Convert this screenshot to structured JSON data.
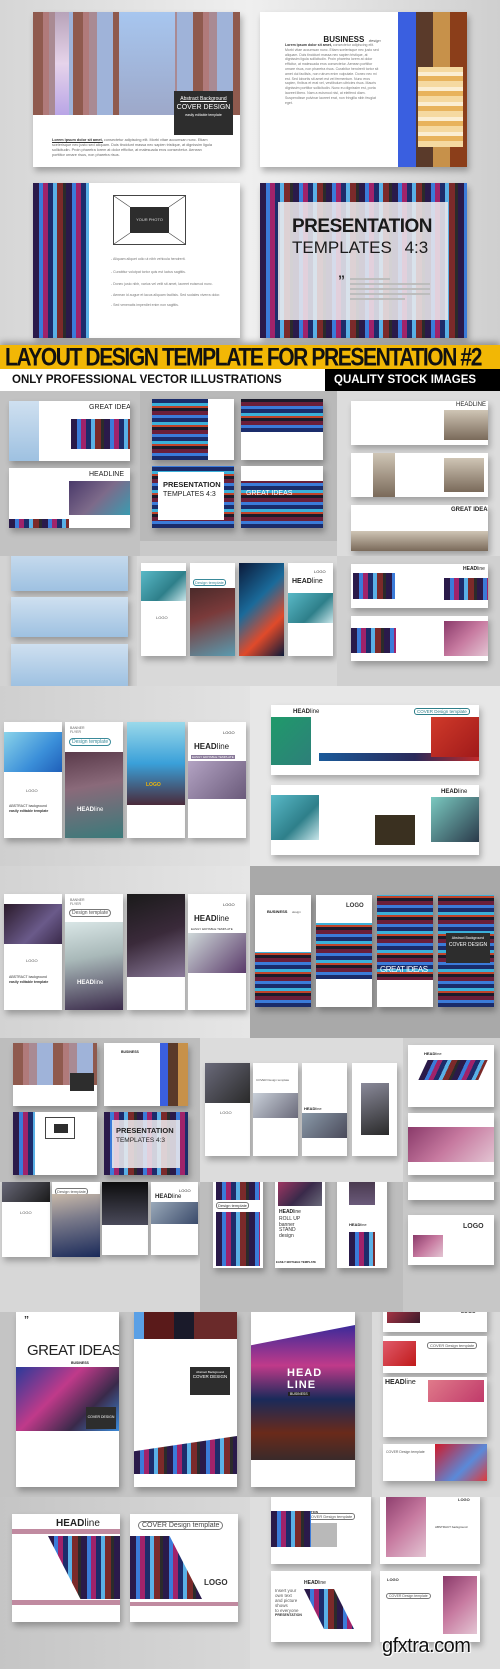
{
  "banner": {
    "title": "LAYOUT DESIGN TEMPLATE FOR PRESENTATION #2",
    "left_tag": "ONLY PROFESSIONAL VECTOR ILLUSTRATIONS",
    "right_tag": "QUALITY STOCK IMAGES",
    "bg_color": "#f2b705",
    "title_color": "#111111"
  },
  "hero": {
    "slide1": {
      "cover_small": "Abstract Background",
      "cover_big": "COVER DESIGN",
      "cover_sub": "easily editable template",
      "body_lead": "Lorem ipsum dolor sit amet,",
      "body": "consectetur adipiscing elit. Morbi vitae accumsan nunc. Etiam scelerisque nec justo sed aliquam. Duis tincidunt massa nec sapien tristique, at dignissim ligula sollicitudin. Proin pharetra lorem at dolor efficitur, at malesuada eros consectetur. Aenean porttitor ornare risus, non pharetra risus."
    },
    "slide2": {
      "title": "BUSINESS",
      "title_suffix": "design",
      "body_lead": "Lorem ipsum dolor sit amet,",
      "body": "consectetur adipiscing elit. Morbi vitae accumsan nunc. Etiam scelerisque nec justo sed aliquam. Duis tincidunt massa nec sapien tristique, at dignissim ligula sollicitudin. Proin pharetra lorem at dolor efficitur, at malesuada eros consectetur. Aenean porttitor ornare risus, non pharetra risus. Curabitur hendrerit tortor sit amet dui facilisis, non rutrum enim vulputate. Donec nec mi est. Sed lobortis sit amet est vel fermentum. Nunc eros sapien, finibus et erat vel, vestibulum ultricies risus. Mauris dignissim porttitor sollicitudin. Nunc eu dignissim est, porta laoreet libero. Nam a euismod nisl, at eleifend diam. Suspendisse pulvinar laoreet erat, non fringilla nibh feugiat eget."
    },
    "slide3": {
      "photo_label": "YOUR PHOTO",
      "bullets": [
        "- Aliquam aliquet odio ut nibh vehicula hendrerit.",
        "- Curabitur volutpat tortor quis est luctus sagittis.",
        "- Donec justo nibh, varius vel velit sit amet, laoreet euismod nunc.",
        "- Aenean id augue et lacus aliquam facilisis. Sed sodales viverra dolor.",
        "- Sed venenatis imperdiet enim non sagittis."
      ]
    },
    "slide4": {
      "title_line1": "PRESENTATION",
      "title_line2": "TEMPLATES",
      "ratio": "4:3",
      "quote_mark": "”"
    }
  },
  "thumbs": {
    "great_ideas": "GREAT IDEAS",
    "headline": "HEADLINE",
    "presentation": "PRESENTATION",
    "templates": "TEMPLATES 4:3",
    "headline_mixed_bold": "HEAD",
    "headline_mixed_light": "line",
    "design_template": "Design template",
    "cover_design_template": "COVER Design template",
    "logo": "LOGO",
    "business": "BUSINESS",
    "business_suffix": "design",
    "abstract": "ABSTRACT background",
    "easily_editable": "easily editable template",
    "easily_editable_caps": "EASILY EDITABLE TEMPLATE",
    "banner_flyer": "BANNER FLYER",
    "cover_design": "COVER DESIGN",
    "abstract_background": "Abstract Background",
    "roll_up": [
      "ROLL UP",
      "banner",
      "STAND",
      "design"
    ],
    "head_line": [
      "HEAD",
      "LINE"
    ],
    "business_small": "BUSINESS",
    "insert_text": [
      "Insert your",
      "own text",
      "and picture",
      "shows",
      "to everyone"
    ],
    "presentation_small": "PRESENTATION"
  },
  "watermark": "gfxtra.com"
}
